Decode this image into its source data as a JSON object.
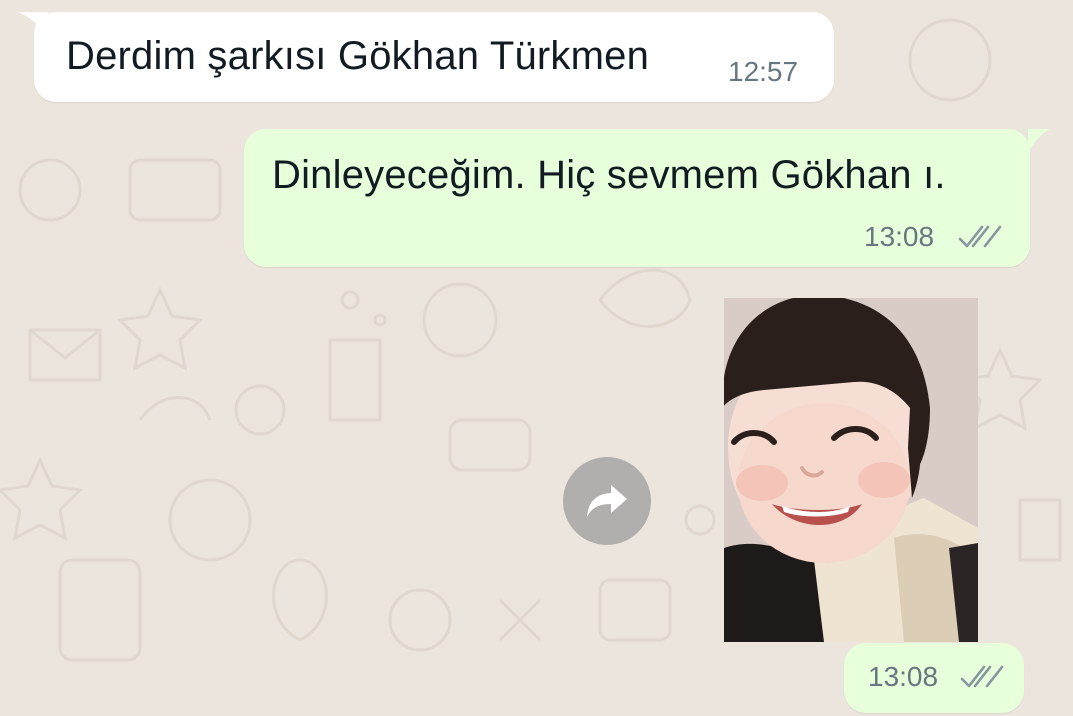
{
  "chat": {
    "messages": [
      {
        "direction": "incoming",
        "text": "Derdim şarkısı Gökhan Türkmen",
        "time": "12:57"
      },
      {
        "direction": "outgoing",
        "text": "Dinleyeceğim. Hiç sevmem Gökhan ı.",
        "time": "13:08",
        "status": "read-double-check"
      },
      {
        "direction": "outgoing",
        "type": "sticker",
        "sticker": "smiling-child-photo-sticker",
        "time": "13:08",
        "status": "read-double-check"
      }
    ],
    "forward_icon": "forward-arrow-icon"
  },
  "colors": {
    "wallpaper": "#ECE5DD",
    "incoming_bubble": "#FFFFFF",
    "outgoing_bubble": "#E7FFDB",
    "text": "#111B21",
    "meta": "#667781"
  }
}
